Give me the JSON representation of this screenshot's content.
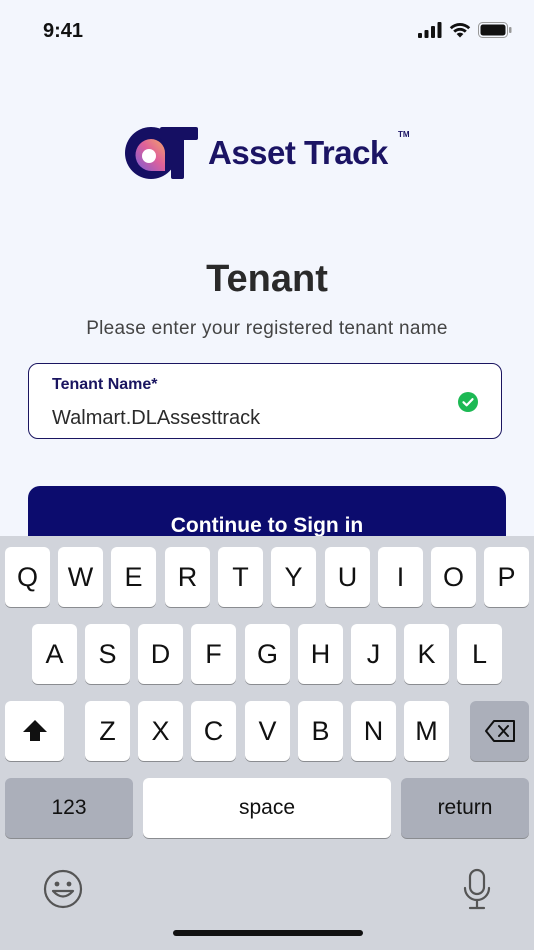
{
  "status_bar": {
    "time": "9:41"
  },
  "logo": {
    "text": "Asset Track",
    "tm": "TM"
  },
  "page": {
    "title": "Tenant",
    "subtitle": "Please enter your registered tenant name"
  },
  "tenant_field": {
    "label": "Tenant Name*",
    "value": "Walmart.DLAssesttrack"
  },
  "continue_button": {
    "label": "Continue to Sign in"
  },
  "keyboard": {
    "row1": [
      "Q",
      "W",
      "E",
      "R",
      "T",
      "Y",
      "U",
      "I",
      "O",
      "P"
    ],
    "row2": [
      "A",
      "S",
      "D",
      "F",
      "G",
      "H",
      "J",
      "K",
      "L"
    ],
    "row3": [
      "Z",
      "X",
      "C",
      "V",
      "B",
      "N",
      "M"
    ],
    "numbers_label": "123",
    "space_label": "space",
    "return_label": "return"
  },
  "colors": {
    "brand": "#0c0c6e",
    "accent_green": "#1db954",
    "background": "#f3f6fd"
  },
  "icons": [
    "signal-icon",
    "wifi-icon",
    "battery-icon",
    "check-icon",
    "shift-icon",
    "backspace-icon",
    "emoji-icon",
    "microphone-icon"
  ]
}
